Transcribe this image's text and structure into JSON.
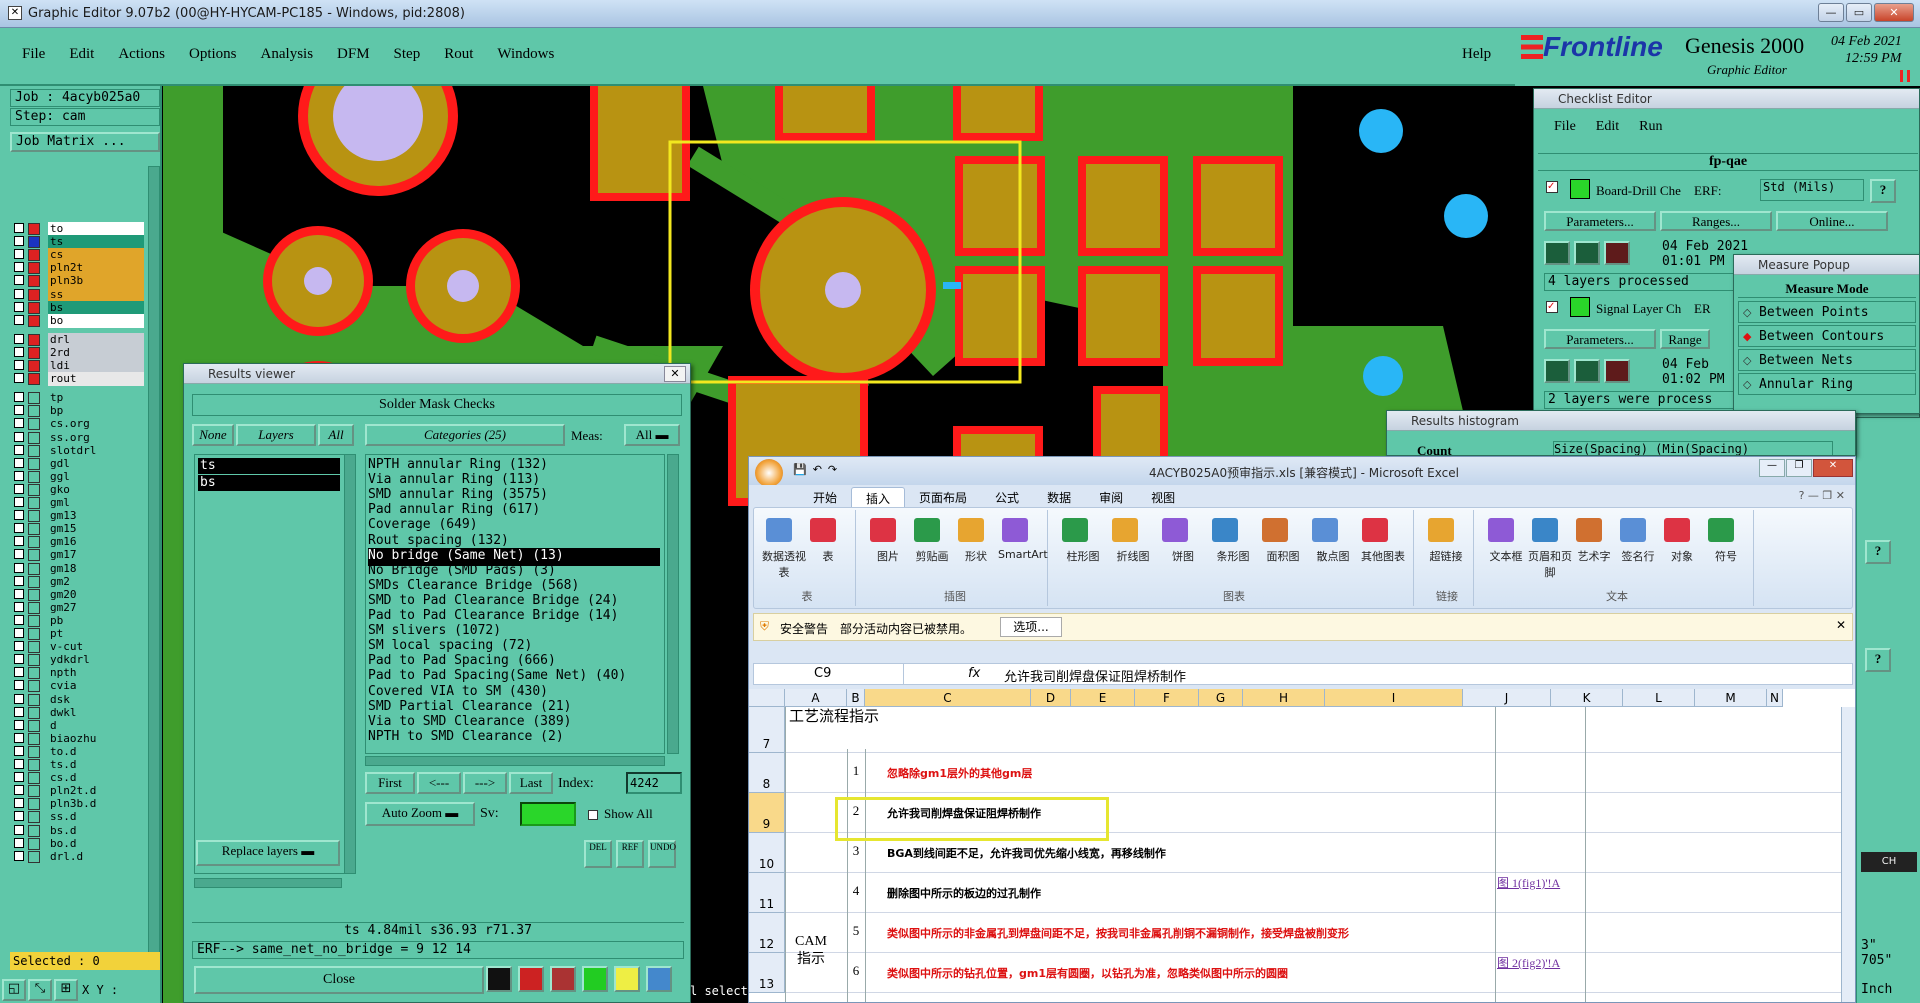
{
  "titlebar": {
    "title": "Graphic Editor 9.07b2 (00@HY-HYCAM-PC185 - Windows, pid:2808)"
  },
  "menubar": {
    "items": [
      "File",
      "Edit",
      "Actions",
      "Options",
      "Analysis",
      "DFM",
      "Step",
      "Rout",
      "Windows"
    ],
    "help": "Help",
    "brand": "Frontline",
    "product": "Genesis 2000",
    "subtitle": "Graphic Editor",
    "date": "04 Feb 2021",
    "time": "12:59 PM"
  },
  "leftpanel": {
    "job": "Job : 4acyb025a0",
    "step": "Step: cam",
    "job_matrix": "Job Matrix ...",
    "selected": "Selected : 0",
    "xy": "X Y :",
    "layers": [
      {
        "name": "to",
        "color": "#ffffff"
      },
      {
        "name": "ts",
        "color": "#1f9a78"
      },
      {
        "name": "cs",
        "color": "#e0a52a"
      },
      {
        "name": "pln2t",
        "color": "#e0a52a"
      },
      {
        "name": "pln3b",
        "color": "#e0a52a"
      },
      {
        "name": "ss",
        "color": "#e0a52a"
      },
      {
        "name": "bs",
        "color": "#1f9a78"
      },
      {
        "name": "bo",
        "color": "#ffffff"
      },
      {
        "name": "drl",
        "color": "#c7cdd4"
      },
      {
        "name": "2rd",
        "color": "#c7cdd4"
      },
      {
        "name": "ldi",
        "color": "#c7cdd4"
      },
      {
        "name": "rout",
        "color": "#e8e8e8"
      },
      {
        "name": "tp",
        "color": "#5fc7a9"
      },
      {
        "name": "bp",
        "color": "#5fc7a9"
      },
      {
        "name": "cs.org",
        "color": "#5fc7a9"
      },
      {
        "name": "ss.org",
        "color": "#5fc7a9"
      },
      {
        "name": "slotdrl",
        "color": "#5fc7a9"
      },
      {
        "name": "gdl",
        "color": "#5fc7a9"
      },
      {
        "name": "ggl",
        "color": "#5fc7a9"
      },
      {
        "name": "gko",
        "color": "#5fc7a9"
      },
      {
        "name": "gml",
        "color": "#5fc7a9"
      },
      {
        "name": "gm13",
        "color": "#5fc7a9"
      },
      {
        "name": "gm15",
        "color": "#5fc7a9"
      },
      {
        "name": "gm16",
        "color": "#5fc7a9"
      },
      {
        "name": "gm17",
        "color": "#5fc7a9"
      },
      {
        "name": "gm18",
        "color": "#5fc7a9"
      },
      {
        "name": "gm2",
        "color": "#5fc7a9"
      },
      {
        "name": "gm20",
        "color": "#5fc7a9"
      },
      {
        "name": "gm27",
        "color": "#5fc7a9"
      },
      {
        "name": "pb",
        "color": "#5fc7a9"
      },
      {
        "name": "pt",
        "color": "#5fc7a9"
      },
      {
        "name": "v-cut",
        "color": "#5fc7a9"
      },
      {
        "name": "ydkdrl",
        "color": "#5fc7a9"
      },
      {
        "name": "npth",
        "color": "#5fc7a9"
      },
      {
        "name": "cvia",
        "color": "#5fc7a9"
      },
      {
        "name": "dsk",
        "color": "#5fc7a9"
      },
      {
        "name": "dwkl",
        "color": "#5fc7a9"
      },
      {
        "name": "d",
        "color": "#5fc7a9"
      },
      {
        "name": "biaozhu",
        "color": "#5fc7a9"
      },
      {
        "name": "to.d",
        "color": "#5fc7a9"
      },
      {
        "name": "ts.d",
        "color": "#5fc7a9"
      },
      {
        "name": "cs.d",
        "color": "#5fc7a9"
      },
      {
        "name": "pln2t.d",
        "color": "#5fc7a9"
      },
      {
        "name": "pln3b.d",
        "color": "#5fc7a9"
      },
      {
        "name": "ss.d",
        "color": "#5fc7a9"
      },
      {
        "name": "bs.d",
        "color": "#5fc7a9"
      },
      {
        "name": "bo.d",
        "color": "#5fc7a9"
      },
      {
        "name": "drl.d",
        "color": "#5fc7a9"
      }
    ]
  },
  "results_viewer": {
    "title": "Results viewer",
    "header": "Solder Mask Checks",
    "none": "None",
    "layers": "Layers",
    "all": "All",
    "categories": "Categories (25)",
    "meas": "Meas:",
    "meas_value": "All",
    "layer_items": [
      "ts",
      "bs"
    ],
    "category_items": [
      "NPTH annular Ring (132)",
      "Via annular Ring (113)",
      "SMD annular Ring (3575)",
      "Pad annular Ring (617)",
      "Coverage (649)",
      "Rout spacing (132)",
      "No bridge (Same Net) (13)",
      "No Bridge (SMD Pads) (3)",
      "SMDs Clearance Bridge (568)",
      "SMD to Pad Clearance Bridge (24)",
      "Pad to Pad Clearance Bridge (14)",
      "SM slivers (1072)",
      "SM local spacing (72)",
      "Pad to Pad Spacing (666)",
      "Pad to Pad Spacing(Same Net) (40)",
      "Covered VIA to SM (430)",
      "SMD Partial Clearance (21)",
      "Via to SMD Clearance (389)",
      "NPTH to SMD Clearance (2)"
    ],
    "first": "First",
    "prev": "<---",
    "next": "--->",
    "last": "Last",
    "index_label": "Index:",
    "index_value": "4242",
    "auto_zoom": "Auto Zoom",
    "sv": "Sv:",
    "show_all": "Show All",
    "replace_layers": "Replace layers",
    "status": "ts 4.84mil   s36.93   r71.37",
    "erf": "ERF--> same_net_no_bridge = 9 12 14",
    "close": "Close",
    "del": "DEL",
    "ref": "REF",
    "undo": "UNDO"
  },
  "checklist": {
    "title": "Checklist Editor",
    "menu": [
      "File",
      "Edit",
      "Run"
    ],
    "name": "fp-qae",
    "row1_label": "Board-Drill Che",
    "erf": "ERF:",
    "std": "Std (Mils)",
    "parameters": "Parameters...",
    "ranges": "Ranges...",
    "online": "Online...",
    "date1": "04 Feb 2021",
    "time1": "01:01 PM",
    "processed1": "4 layers processed",
    "row2_label": "Signal Layer Ch",
    "erf2": "ER",
    "ranges2": "Range",
    "date2": "04 Feb",
    "time2": "01:02 PM",
    "processed2": "2 layers were process"
  },
  "measure_popup": {
    "title": "Measure Popup",
    "mode": "Measure Mode",
    "items": [
      "Between Points",
      "Between Contours",
      "Between Nets",
      "Annular Ring"
    ],
    "selected_index": 1,
    "extra": "oints"
  },
  "results_histogram": {
    "title": "Results histogram",
    "count": "Count",
    "size": "Size(Spacing) (Min(Spacing)"
  },
  "excel": {
    "title": "4ACYB025A0预审指示.xls  [兼容模式] - Microsoft Excel",
    "tabs": [
      "开始",
      "插入",
      "页面布局",
      "公式",
      "数据",
      "审阅",
      "视图"
    ],
    "active_tab": "插入",
    "ribbon_groups": [
      {
        "name": "表",
        "items": [
          "数据透视表",
          "表"
        ]
      },
      {
        "name": "插图",
        "items": [
          "图片",
          "剪贴画",
          "形状",
          "SmartArt"
        ]
      },
      {
        "name": "图表",
        "items": [
          "柱形图",
          "折线图",
          "饼图",
          "条形图",
          "面积图",
          "散点图",
          "其他图表"
        ]
      },
      {
        "name": "链接",
        "items": [
          "超链接"
        ]
      },
      {
        "name": "文本",
        "items": [
          "文本框",
          "页眉和页脚",
          "艺术字",
          "签名行",
          "对象",
          "符号"
        ]
      }
    ],
    "security": "安全警告",
    "security_msg": "部分活动内容已被禁用。",
    "options": "选项...",
    "namebox": "C9",
    "fx": "fx",
    "formula": "允许我司削焊盘保证阻焊桥制作",
    "columns": [
      "A",
      "B",
      "C",
      "D",
      "E",
      "F",
      "G",
      "H",
      "I",
      "J",
      "K",
      "L",
      "M",
      "N"
    ],
    "rows": [
      {
        "num": "7",
        "b": "",
        "text": "",
        "color": "#000",
        "j": ""
      },
      {
        "num": "8",
        "b": "1",
        "text": "忽略除gm1层外的其他gm层",
        "color": "#d11",
        "j": ""
      },
      {
        "num": "9",
        "b": "2",
        "text": "允许我司削焊盘保证阻焊桥制作",
        "color": "#000",
        "j": ""
      },
      {
        "num": "10",
        "b": "3",
        "text": "BGA到线间距不足，允许我司优先缩小线宽，再移线制作",
        "color": "#000",
        "j": ""
      },
      {
        "num": "11",
        "b": "4",
        "text": "删除图中所示的板边的过孔制作",
        "color": "#000",
        "j": "图 1(fig1)'!A"
      },
      {
        "num": "12",
        "b": "5",
        "text": "类似图中所示的非金属孔到焊盘间距不足，按我司非金属孔削铜不漏铜制作，接受焊盘被削变形",
        "color": "#d11",
        "j": ""
      },
      {
        "num": "13",
        "b": "6",
        "text": "类似图中所示的钻孔位置，gm1层有圆圈，以钻孔为准，忽略类似图中所示的圆圈",
        "color": "#d11",
        "j": "图 2(fig2)'!A"
      }
    ],
    "a7": "工艺流程指示",
    "a12": "CAM指示"
  },
  "right_misc": {
    "ch": "CH",
    "coord1": "3\"",
    "coord2": "705\"",
    "inch": "Inch",
    "select": "l select"
  }
}
